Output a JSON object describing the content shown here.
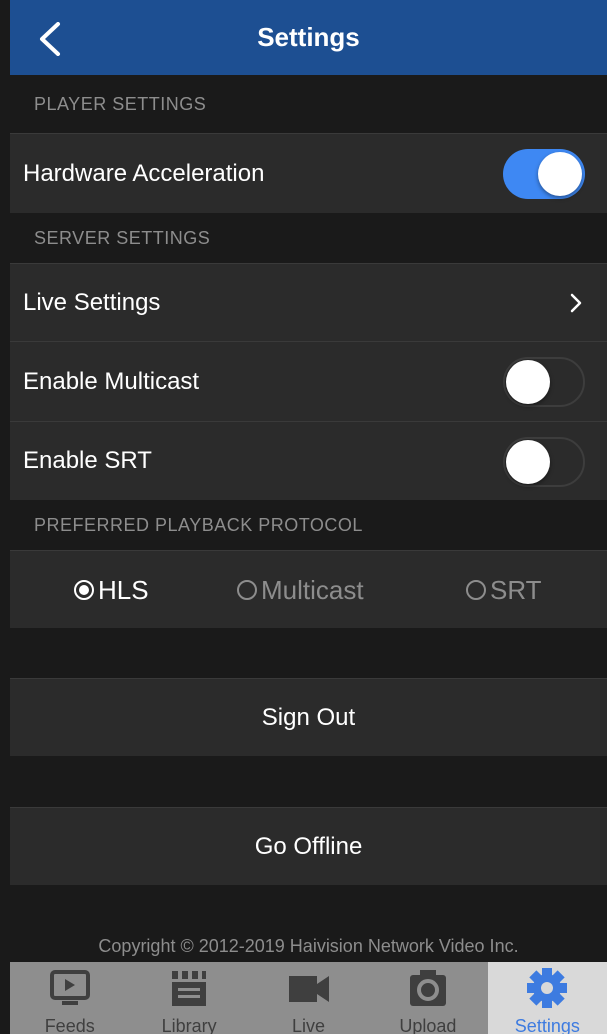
{
  "navbar": {
    "title": "Settings",
    "back_icon": "chevron-left-icon"
  },
  "player_settings": {
    "header": "PLAYER SETTINGS",
    "hardware_acceleration": {
      "label": "Hardware Acceleration",
      "enabled": true
    }
  },
  "server_settings": {
    "header": "SERVER SETTINGS",
    "live_settings": {
      "label": "Live Settings"
    },
    "enable_multicast": {
      "label": "Enable Multicast",
      "enabled": false
    },
    "enable_srt": {
      "label": "Enable SRT",
      "enabled": false
    }
  },
  "playback_protocol": {
    "header": "PREFERRED PLAYBACK PROTOCOL",
    "options": [
      {
        "label": "HLS",
        "selected": true
      },
      {
        "label": "Multicast",
        "selected": false
      },
      {
        "label": "SRT",
        "selected": false
      }
    ]
  },
  "actions": {
    "sign_out": "Sign Out",
    "go_offline": "Go Offline"
  },
  "copyright": "Copyright © 2012-2019 Haivision Network Video Inc.",
  "tabbar": {
    "tabs": [
      {
        "label": "Feeds",
        "icon": "feeds-icon",
        "active": false
      },
      {
        "label": "Library",
        "icon": "clapperboard-icon",
        "active": false
      },
      {
        "label": "Live",
        "icon": "video-camera-icon",
        "active": false
      },
      {
        "label": "Upload",
        "icon": "camera-icon",
        "active": false
      },
      {
        "label": "Settings",
        "icon": "gear-icon",
        "active": true
      }
    ]
  },
  "colors": {
    "navbar": "#1d4f92",
    "toggle_on": "#3e88f3",
    "active_tab": "#3d7be0",
    "background": "#1a1a1a",
    "row": "#2b2b2b"
  }
}
